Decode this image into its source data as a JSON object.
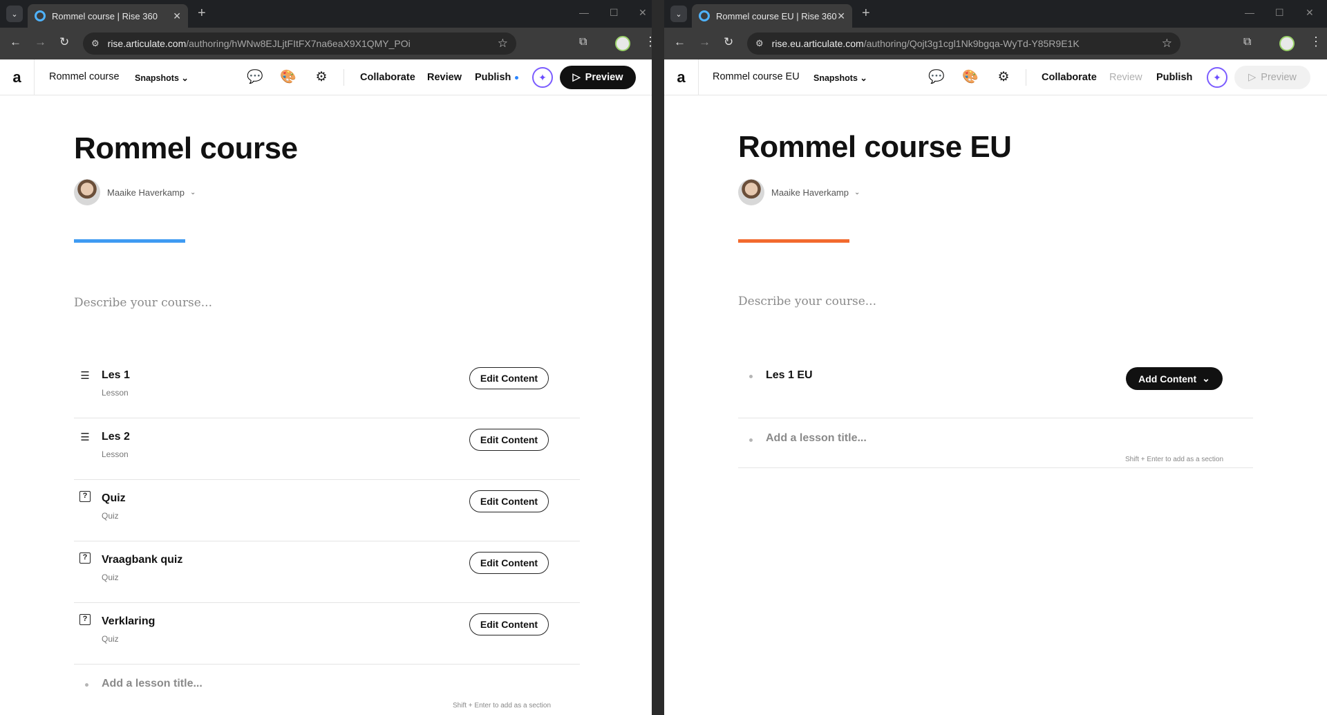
{
  "left_window": {
    "tab_title": "Rommel course | Rise 360",
    "url_host": "rise.articulate.com",
    "url_path": "/authoring/hWNw8EJLjtFItFX7na6eaX9X1QMY_POi",
    "header": {
      "course_title": "Rommel course",
      "snapshots": "Snapshots",
      "collaborate": "Collaborate",
      "review": "Review",
      "publish": "Publish",
      "preview": "Preview"
    },
    "course": {
      "title": "Rommel course",
      "author": "Maaike Haverkamp",
      "description_placeholder": "Describe your course...",
      "accent_color": "#3f9bf2",
      "lessons": [
        {
          "icon": "lines-icon",
          "title": "Les 1",
          "type": "Lesson",
          "button": "Edit Content"
        },
        {
          "icon": "lines-icon",
          "title": "Les 2",
          "type": "Lesson",
          "button": "Edit Content"
        },
        {
          "icon": "question-box-icon",
          "title": "Quiz",
          "type": "Quiz",
          "button": "Edit Content"
        },
        {
          "icon": "question-box-icon",
          "title": "Vraagbank quiz",
          "type": "Quiz",
          "button": "Edit Content"
        },
        {
          "icon": "question-box-icon",
          "title": "Verklaring",
          "type": "Quiz",
          "button": "Edit Content"
        }
      ],
      "add_lesson_placeholder": "Add a lesson title...",
      "hint": "Shift + Enter to add as a section"
    }
  },
  "right_window": {
    "tab_title": "Rommel course EU | Rise 360",
    "url_host": "rise.eu.articulate.com",
    "url_path": "/authoring/Qojt3g1cgl1Nk9bgqa-WyTd-Y85R9E1K",
    "header": {
      "course_title": "Rommel course EU",
      "snapshots": "Snapshots",
      "collaborate": "Collaborate",
      "review": "Review",
      "publish": "Publish",
      "preview": "Preview"
    },
    "course": {
      "title": "Rommel course EU",
      "author": "Maaike Haverkamp",
      "description_placeholder": "Describe your course...",
      "accent_color": "#f26a2e",
      "lessons": [
        {
          "title": "Les 1 EU",
          "button": "Add Content"
        }
      ],
      "add_lesson_placeholder": "Add a lesson title...",
      "hint": "Shift + Enter to add as a section"
    }
  }
}
